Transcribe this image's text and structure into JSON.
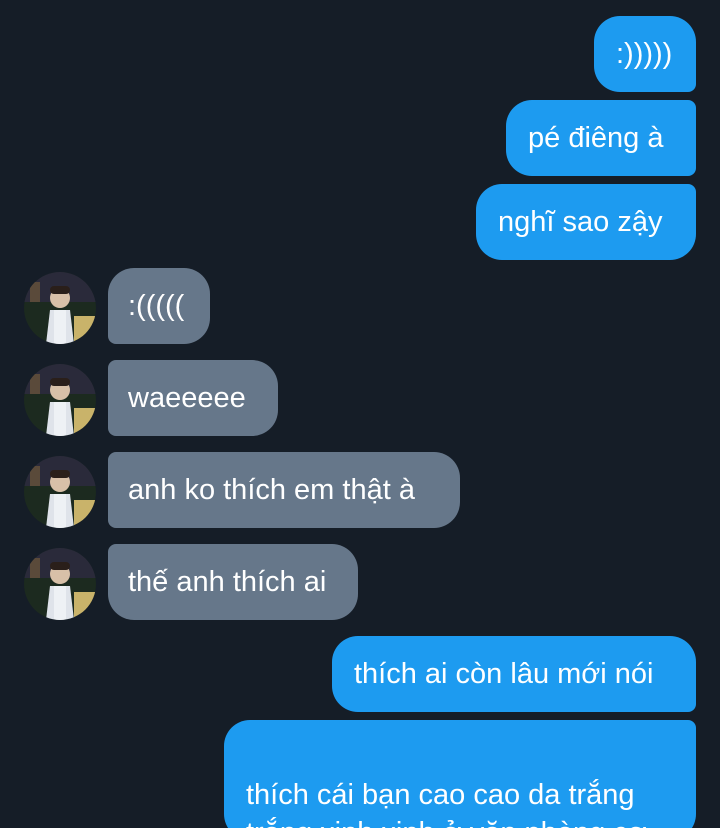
{
  "colors": {
    "background": "#151d27",
    "sent_bubble": "#1d9bf0",
    "received_bubble": "#66778a",
    "text": "#ffffff"
  },
  "messages": [
    {
      "direction": "sent",
      "text": ":)))))"
    },
    {
      "direction": "sent",
      "text": "pé điêng à"
    },
    {
      "direction": "sent",
      "text": "nghĩ sao zậy"
    },
    {
      "direction": "received",
      "text": ":(((((",
      "avatar": "user-avatar"
    },
    {
      "direction": "received",
      "text": "waeeeee",
      "avatar": "user-avatar"
    },
    {
      "direction": "received",
      "text": "anh ko thích em thật à",
      "avatar": "user-avatar"
    },
    {
      "direction": "received",
      "text": "thế anh thích ai",
      "avatar": "user-avatar"
    },
    {
      "direction": "sent",
      "text": "thích ai còn lâu mới nói"
    },
    {
      "direction": "sent",
      "text": "thích cái bạn cao cao da trắng\ntrắng xinh xinh ở văn phòng cơ"
    }
  ]
}
